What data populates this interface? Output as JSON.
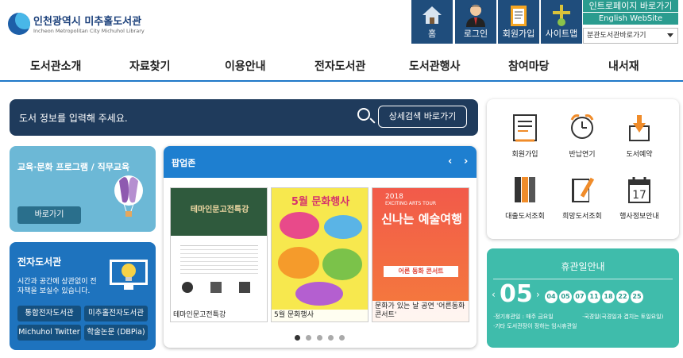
{
  "header": {
    "logo_title": "인천광역시 미추홀도서관",
    "logo_subtitle": "Incheon Metropolitan City Michuhol Library",
    "buttons": [
      {
        "label": "홈",
        "icon": "home-icon"
      },
      {
        "label": "로그인",
        "icon": "user-icon"
      },
      {
        "label": "회원가입",
        "icon": "clipboard-icon"
      },
      {
        "label": "사이트맵",
        "icon": "sitemap-icon"
      }
    ],
    "intro_link": "인트로페이지 바로가기",
    "english_link": "English WebSite",
    "branch_select": "분관도서관바로가기"
  },
  "nav": [
    "도서관소개",
    "자료찾기",
    "이용안내",
    "전자도서관",
    "도서관행사",
    "참여마당",
    "내서재"
  ],
  "search": {
    "placeholder": "도서 정보를 입력해 주세요.",
    "advanced": "상세검색 바로가기"
  },
  "edu": {
    "title": "교육·문화 프로그램 / 직무교육",
    "button": "바로가기"
  },
  "elib": {
    "title": "전자도서관",
    "desc": "시간과 공간에 상관없이 전자책을 보실수 있습니다.",
    "links": [
      "통합전자도서관",
      "미추홀전자도서관",
      "Michuhol Twitter",
      "학술논문 (DBPia)"
    ]
  },
  "popup": {
    "title": "팝업존",
    "prev": "‹",
    "next": "›",
    "posters": [
      {
        "headline": "테마인문고전특강",
        "caption": "테마인문고전특강"
      },
      {
        "headline": "5월 문화행사",
        "caption": "5월 문화행사"
      },
      {
        "headline": "신나는 예술여행",
        "caption": "문화가 있는 날 공연 '어른동화 콘서트'"
      }
    ],
    "poster_texts": {
      "p3_year": "2018",
      "p3_tour": "EXCITING ARTS TOUR",
      "p3_banner": "어른 동화 콘서트"
    }
  },
  "quick": [
    {
      "label": "회원가입",
      "icon": "board-icon"
    },
    {
      "label": "반납연기",
      "icon": "alarm-clock-icon"
    },
    {
      "label": "도서예약",
      "icon": "box-arrow-icon"
    },
    {
      "label": "대출도서조회",
      "icon": "books-icon"
    },
    {
      "label": "희망도서조회",
      "icon": "book-pencil-icon"
    },
    {
      "label": "행사정보안내",
      "icon": "calendar-icon"
    }
  ],
  "closed": {
    "title": "휴관일안내",
    "month": "05",
    "days": [
      "04",
      "05",
      "07",
      "11",
      "18",
      "22",
      "25"
    ],
    "note1": "·정기휴관일 : 매주 금요일",
    "note2": "·국경일(국경일과 겹치는 토일요일)",
    "note3": "·기타 도서관장이 정하는 임시휴관일"
  },
  "colors": {
    "navy": "#1f4d7c",
    "teal": "#3fbcab",
    "blue": "#1e7fd0"
  }
}
